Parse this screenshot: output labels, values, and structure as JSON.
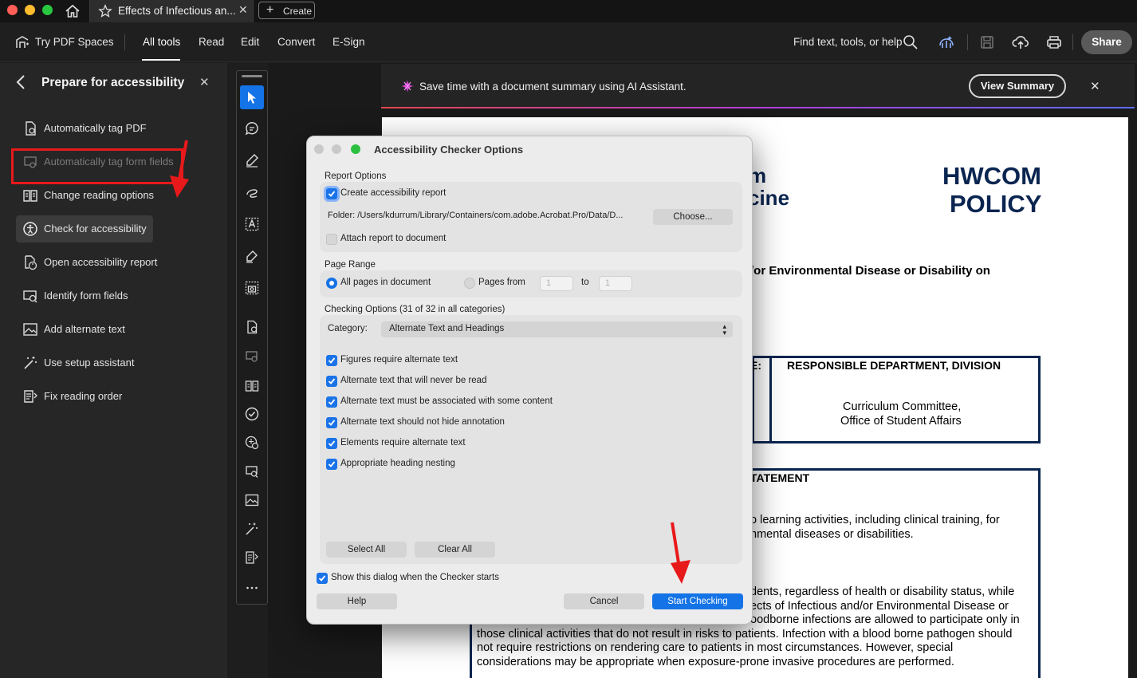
{
  "window": {
    "tab_title": "Effects of Infectious an...",
    "create_label": "Create"
  },
  "menubar": {
    "try_pdf_spaces": "Try PDF Spaces",
    "items": [
      "All tools",
      "Read",
      "Edit",
      "Convert",
      "E-Sign"
    ],
    "active_item": "All tools",
    "search_label": "Find text, tools, or help",
    "share_label": "Share"
  },
  "left_panel": {
    "title": "Prepare for accessibility",
    "items": [
      {
        "label": "Automatically tag PDF",
        "icon": "tag-pdf-icon",
        "enabled": true
      },
      {
        "label": "Automatically tag form fields",
        "icon": "tag-form-fields-icon",
        "enabled": false
      },
      {
        "label": "Change reading options",
        "icon": "reading-options-icon",
        "enabled": true
      },
      {
        "label": "Check for accessibility",
        "icon": "accessibility-check-icon",
        "enabled": true,
        "selected": true
      },
      {
        "label": "Open accessibility report",
        "icon": "accessibility-report-icon",
        "enabled": true
      },
      {
        "label": "Identify form fields",
        "icon": "form-fields-icon",
        "enabled": true
      },
      {
        "label": "Add alternate text",
        "icon": "alt-text-icon",
        "enabled": true
      },
      {
        "label": "Use setup assistant",
        "icon": "setup-assistant-icon",
        "enabled": true
      },
      {
        "label": "Fix reading order",
        "icon": "reading-order-icon",
        "enabled": true
      }
    ]
  },
  "ai_banner": {
    "text": "Save time with a document summary using AI Assistant.",
    "button": "View Summary"
  },
  "document": {
    "name_line1": "m",
    "name_line2": "cine",
    "policy_line1": "HWCOM",
    "policy_line2": "POLICY",
    "subject": "/or Environmental Disease or Disability on",
    "table_left_header": "E:",
    "table_right_header": "RESPONSIBLE DEPARTMENT, DIVISION",
    "dept_line1": "Curriculum Committee,",
    "dept_line2": "Office of Student Affairs",
    "statement_heading": "TATEMENT",
    "para1_line1": "o learning activities, including clinical training, for",
    "para1_line2": "nmental diseases or disabilities.",
    "para2_line1": "dents, regardless of health or disability status, while",
    "para2_line2": "ects of Infectious and/or Environmental Disease or",
    "para2_line3": "oodborne infections are allowed to participate only in",
    "para2_line4": "those clinical activities that do not result in risks to patients. Infection with a blood borne pathogen should",
    "para2_line5": "not require restrictions on rendering care to patients in most circumstances. However, special",
    "para2_line6": "considerations may be appropriate when exposure-prone invasive procedures are performed."
  },
  "dialog": {
    "title": "Accessibility Checker Options",
    "report_options_label": "Report Options",
    "create_report_label": "Create accessibility report",
    "create_report_checked": true,
    "folder_text": "Folder: /Users/kdurrum/Library/Containers/com.adobe.Acrobat.Pro/Data/D...",
    "choose_label": "Choose...",
    "attach_report_label": "Attach report to document",
    "attach_report_checked": false,
    "page_range_label": "Page Range",
    "all_pages_label": "All pages in document",
    "pages_from_label": "Pages from",
    "from_value": "1",
    "to_label": "to",
    "to_value": "1",
    "checking_options_label": "Checking Options (31 of 32 in all categories)",
    "category_label": "Category:",
    "category_value": "Alternate Text and Headings",
    "options": [
      {
        "label": "Figures require alternate text",
        "checked": true
      },
      {
        "label": "Alternate text that will never be read",
        "checked": true
      },
      {
        "label": "Alternate text must be associated with some content",
        "checked": true
      },
      {
        "label": "Alternate text should not hide annotation",
        "checked": true
      },
      {
        "label": "Elements require alternate text",
        "checked": true
      },
      {
        "label": "Appropriate heading nesting",
        "checked": true
      }
    ],
    "select_all_label": "Select All",
    "clear_all_label": "Clear All",
    "show_dialog_label": "Show this dialog when the Checker starts",
    "show_dialog_checked": true,
    "help_label": "Help",
    "cancel_label": "Cancel",
    "start_label": "Start Checking"
  },
  "colors": {
    "accent_blue": "#1473e6",
    "annotation_red": "#e8191b",
    "policy_navy": "#0a2550"
  }
}
